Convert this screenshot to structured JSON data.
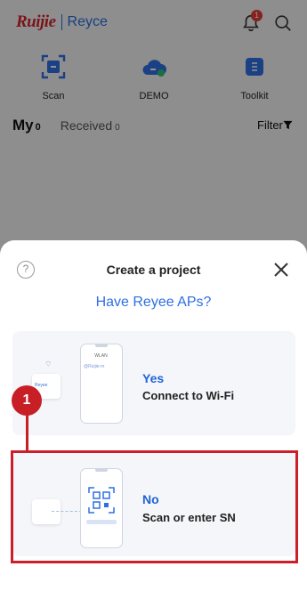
{
  "header": {
    "brand": "Ruijie",
    "sub_brand": "Reyce",
    "notification_count": "1"
  },
  "quick_actions": [
    {
      "label": "Scan",
      "icon": "scan-icon"
    },
    {
      "label": "DEMO",
      "icon": "cloud-icon"
    },
    {
      "label": "Toolkit",
      "icon": "toolkit-icon"
    }
  ],
  "tabs": {
    "my_label": "My",
    "my_count": "0",
    "received_label": "Received",
    "received_count": "0",
    "filter_label": "Filter"
  },
  "sheet": {
    "title": "Create a project",
    "question": "Have Reyee APs?",
    "options": [
      {
        "title": "Yes",
        "description": "Connect to Wi-Fi",
        "illustration": {
          "wlan_label": "WLAN",
          "ssid": "@Ruijie-m",
          "device_label": "Reyee"
        }
      },
      {
        "title": "No",
        "description": "Scan or enter SN"
      }
    ]
  },
  "annotation": {
    "marker_number": "1",
    "color": "#cc1f29"
  },
  "colors": {
    "accent": "#2f6fe4",
    "brand_red": "#d2232a"
  }
}
